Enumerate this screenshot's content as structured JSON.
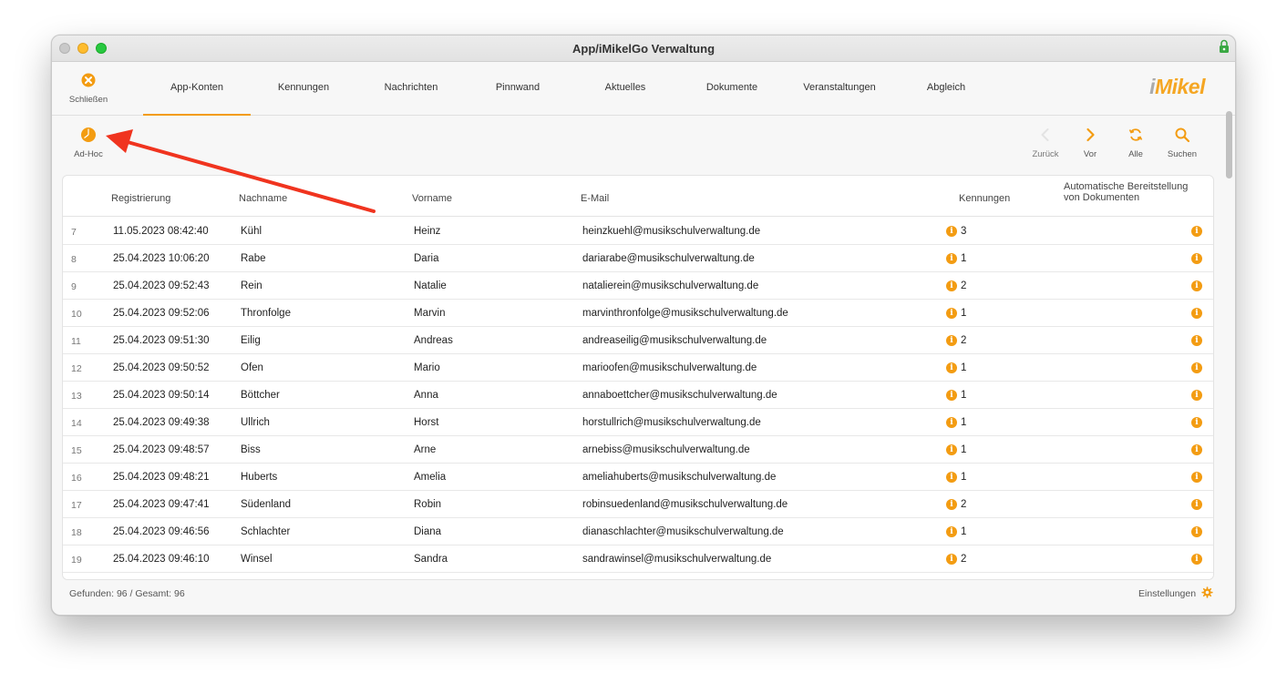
{
  "window": {
    "title": "App/iMikelGo Verwaltung"
  },
  "header": {
    "close_label": "Schließen",
    "tabs": [
      {
        "label": "App-Konten"
      },
      {
        "label": "Kennungen"
      },
      {
        "label": "Nachrichten"
      },
      {
        "label": "Pinnwand"
      },
      {
        "label": "Aktuelles"
      },
      {
        "label": "Dokumente"
      },
      {
        "label": "Veranstaltungen"
      },
      {
        "label": "Abgleich"
      }
    ],
    "logo_text": "iMikel"
  },
  "toolbar": {
    "adhoc_label": "Ad-Hoc",
    "back_label": "Zurück",
    "forward_label": "Vor",
    "all_label": "Alle",
    "search_label": "Suchen"
  },
  "table": {
    "headers": {
      "registrierung": "Registrierung",
      "nachname": "Nachname",
      "vorname": "Vorname",
      "email": "E-Mail",
      "kennungen": "Kennungen",
      "auto_line1": "Automatische Bereitstellung",
      "auto_line2": "von Dokumenten"
    },
    "rows": [
      {
        "nr": "7",
        "reg": "11.05.2023 08:42:40",
        "nachname": "Kühl",
        "vorname": "Heinz",
        "email": "heinzkuehl@musikschulverwaltung.de",
        "kennungen": "3"
      },
      {
        "nr": "8",
        "reg": "25.04.2023 10:06:20",
        "nachname": "Rabe",
        "vorname": "Daria",
        "email": "dariarabe@musikschulverwaltung.de",
        "kennungen": "1"
      },
      {
        "nr": "9",
        "reg": "25.04.2023 09:52:43",
        "nachname": "Rein",
        "vorname": "Natalie",
        "email": "natalierein@musikschulverwaltung.de",
        "kennungen": "2"
      },
      {
        "nr": "10",
        "reg": "25.04.2023 09:52:06",
        "nachname": "Thronfolge",
        "vorname": "Marvin",
        "email": "marvinthronfolge@musikschulverwaltung.de",
        "kennungen": "1"
      },
      {
        "nr": "11",
        "reg": "25.04.2023 09:51:30",
        "nachname": "Eilig",
        "vorname": "Andreas",
        "email": "andreaseilig@musikschulverwaltung.de",
        "kennungen": "2"
      },
      {
        "nr": "12",
        "reg": "25.04.2023 09:50:52",
        "nachname": "Ofen",
        "vorname": "Mario",
        "email": "marioofen@musikschulverwaltung.de",
        "kennungen": "1"
      },
      {
        "nr": "13",
        "reg": "25.04.2023 09:50:14",
        "nachname": "Böttcher",
        "vorname": "Anna",
        "email": "annaboettcher@musikschulverwaltung.de",
        "kennungen": "1"
      },
      {
        "nr": "14",
        "reg": "25.04.2023 09:49:38",
        "nachname": "Ullrich",
        "vorname": "Horst",
        "email": "horstullrich@musikschulverwaltung.de",
        "kennungen": "1"
      },
      {
        "nr": "15",
        "reg": "25.04.2023 09:48:57",
        "nachname": "Biss",
        "vorname": "Arne",
        "email": "arnebiss@musikschulverwaltung.de",
        "kennungen": "1"
      },
      {
        "nr": "16",
        "reg": "25.04.2023 09:48:21",
        "nachname": "Huberts",
        "vorname": "Amelia",
        "email": "ameliahuberts@musikschulverwaltung.de",
        "kennungen": "1"
      },
      {
        "nr": "17",
        "reg": "25.04.2023 09:47:41",
        "nachname": "Südenland",
        "vorname": "Robin",
        "email": "robinsuedenland@musikschulverwaltung.de",
        "kennungen": "2"
      },
      {
        "nr": "18",
        "reg": "25.04.2023 09:46:56",
        "nachname": "Schlachter",
        "vorname": "Diana",
        "email": "dianaschlachter@musikschulverwaltung.de",
        "kennungen": "1"
      },
      {
        "nr": "19",
        "reg": "25.04.2023 09:46:10",
        "nachname": "Winsel",
        "vorname": "Sandra",
        "email": "sandrawinsel@musikschulverwaltung.de",
        "kennungen": "2"
      }
    ]
  },
  "footer": {
    "found_text": "Gefunden: 96 / Gesamt: 96",
    "settings_label": "Einstellungen"
  },
  "colors": {
    "accent": "#f39c12",
    "annotation_arrow": "#f0341f"
  }
}
